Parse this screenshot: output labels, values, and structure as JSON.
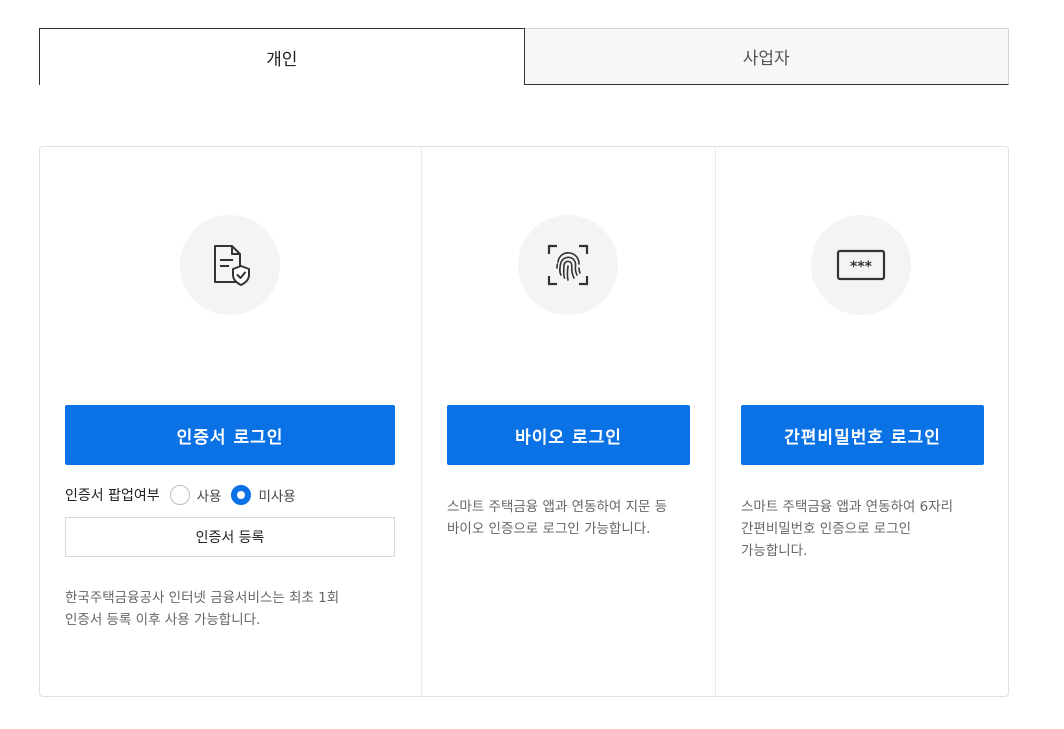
{
  "tabs": [
    {
      "label": "개인",
      "active": true
    },
    {
      "label": "사업자",
      "active": false
    }
  ],
  "colors": {
    "primary": "#0a72e5",
    "icon_bg": "#f4f4f4",
    "text_muted": "#666666"
  },
  "cards": {
    "cert": {
      "icon": "certificate-shield-icon",
      "button_label": "인증서 로그인",
      "popup_label": "인증서 팝업여부",
      "radio_use": "사용",
      "radio_nouse": "미사용",
      "radio_selected": "미사용",
      "register_label": "인증서 등록",
      "desc_line1": "한국주택금융공사 인터넷 금융서비스는 최초 1회",
      "desc_line2": "인증서 등록 이후 사용 가능합니다."
    },
    "bio": {
      "icon": "fingerprint-icon",
      "button_label": "바이오 로그인",
      "desc_line1": "스마트 주택금융 앱과 연동하여 지문 등",
      "desc_line2": "바이오 인증으로 로그인 가능합니다."
    },
    "pin": {
      "icon": "password-field-icon",
      "icon_text": "***",
      "button_label": "간편비밀번호 로그인",
      "desc_line1": "스마트 주택금융 앱과 연동하여 6자리",
      "desc_line2": "간편비밀번호 인증으로 로그인",
      "desc_line3": "가능합니다."
    }
  }
}
